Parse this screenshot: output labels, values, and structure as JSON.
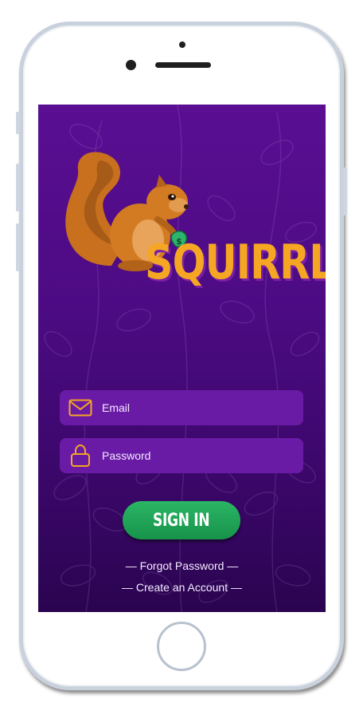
{
  "brand": {
    "name": "SQUIRRL",
    "coin_symbol": "$"
  },
  "login": {
    "email_placeholder": "Email",
    "password_placeholder": "Password",
    "signin_label": "SIGN IN",
    "forgot_label": "— Forgot Password —",
    "create_label": "— Create an Account —"
  },
  "icons": {
    "email": "envelope-icon",
    "password": "padlock-icon"
  },
  "colors": {
    "background": "#4c0b83",
    "field": "#6a1ba6",
    "accent": "#f5a623",
    "button": "#1fa355",
    "text": "#ffffff"
  }
}
